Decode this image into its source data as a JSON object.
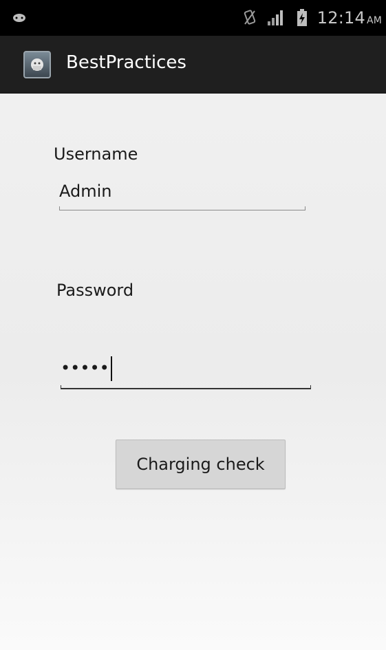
{
  "status_bar": {
    "time": "12:14",
    "ampm": "AM",
    "icons": [
      "android-debug-icon",
      "vibrate-icon",
      "signal-icon",
      "battery-charging-icon"
    ]
  },
  "action_bar": {
    "title": "BestPractices",
    "icon": "app-launcher-icon"
  },
  "form": {
    "username_label": "Username",
    "username_value": "Admin",
    "password_label": "Password",
    "password_value": "•••••",
    "submit_label": "Charging check"
  }
}
